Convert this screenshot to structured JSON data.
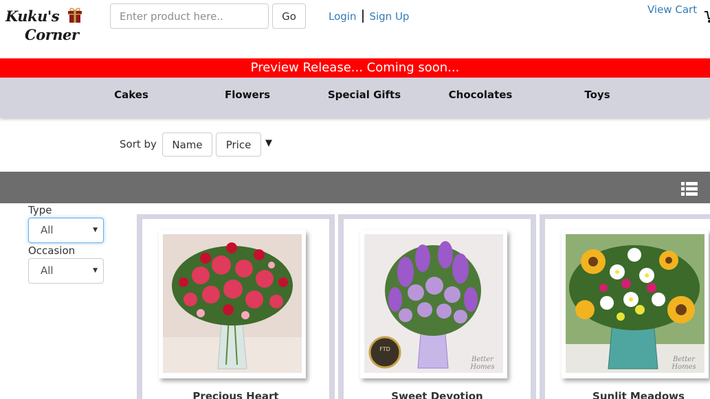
{
  "header": {
    "logo": {
      "line1": "Kuku's",
      "line2": "Corner"
    },
    "search": {
      "placeholder": "Enter product here..",
      "value": ""
    },
    "go_label": "Go",
    "login_label": "Login",
    "signup_label": "Sign Up",
    "view_cart_label": "View Cart"
  },
  "banner": {
    "text": "Preview Release... Coming soon..."
  },
  "categories": [
    "Cakes",
    "Flowers",
    "Special Gifts",
    "Chocolates",
    "Toys"
  ],
  "sort": {
    "label": "Sort by",
    "options": [
      "Name",
      "Price"
    ],
    "direction_icon": "triangle-down-icon"
  },
  "toolbar": {
    "view_icon": "list-view-icon"
  },
  "filters": {
    "type": {
      "label": "Type",
      "selected": "All"
    },
    "occasion": {
      "label": "Occasion",
      "selected": "All"
    }
  },
  "products": [
    {
      "name": "Precious Heart"
    },
    {
      "name": "Sweet Devotion"
    },
    {
      "name": "Sunlit Meadows"
    }
  ],
  "colors": {
    "banner": "#ff0000",
    "nav_background": "#d3d3de",
    "toolbar": "#6d6d6d",
    "link": "#337ab7",
    "card_border": "#d5d5e3"
  }
}
